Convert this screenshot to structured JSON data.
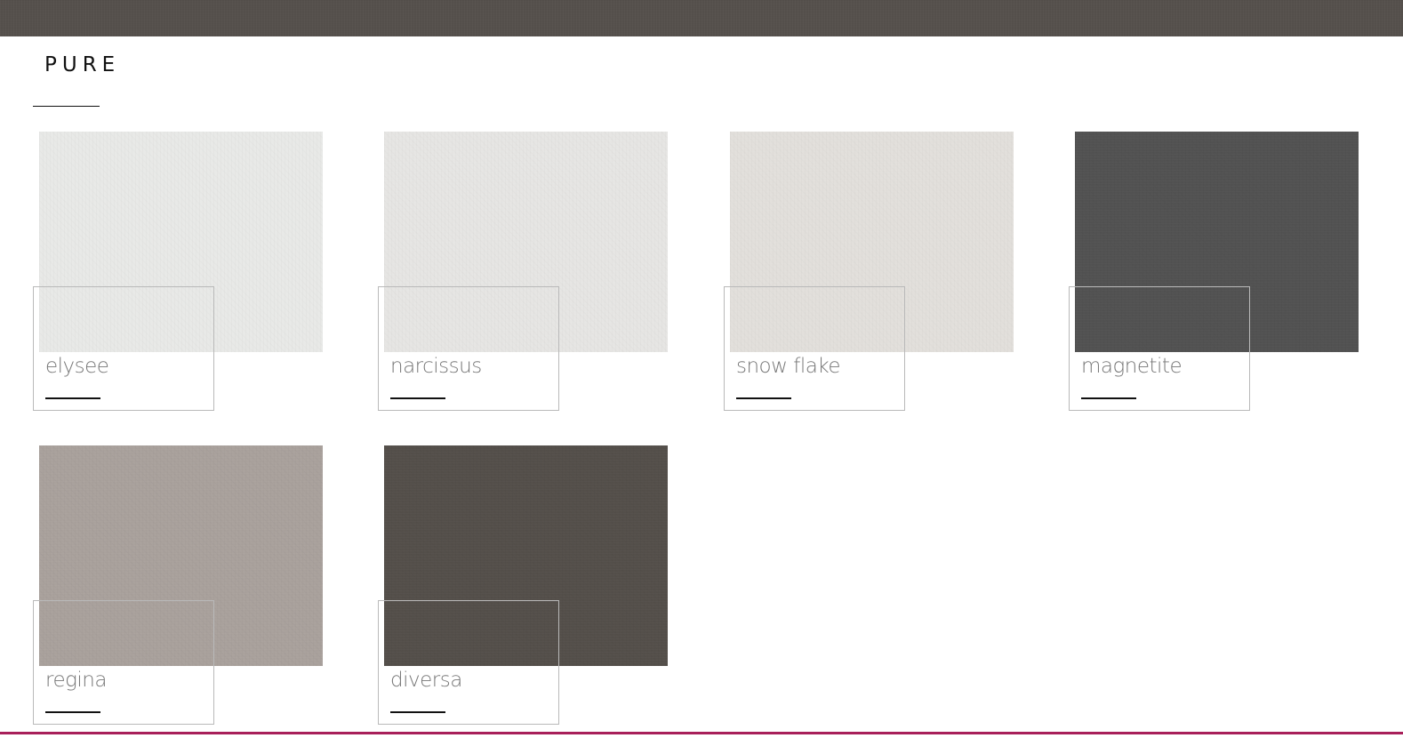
{
  "header": {
    "band_color": "#56514d"
  },
  "section": {
    "title": "PURE"
  },
  "colors": [
    {
      "name": "elysee",
      "swatch": "#e8e9e7"
    },
    {
      "name": "narcissus",
      "swatch": "#e6e5e3"
    },
    {
      "name": "snow flake",
      "swatch": "#e2dfdb"
    },
    {
      "name": "magnetite",
      "swatch": "#525252"
    },
    {
      "name": "regina",
      "swatch": "#a9a19c"
    },
    {
      "name": "diversa",
      "swatch": "#544f4a"
    }
  ],
  "footer": {
    "accent_color": "#a8205a"
  }
}
